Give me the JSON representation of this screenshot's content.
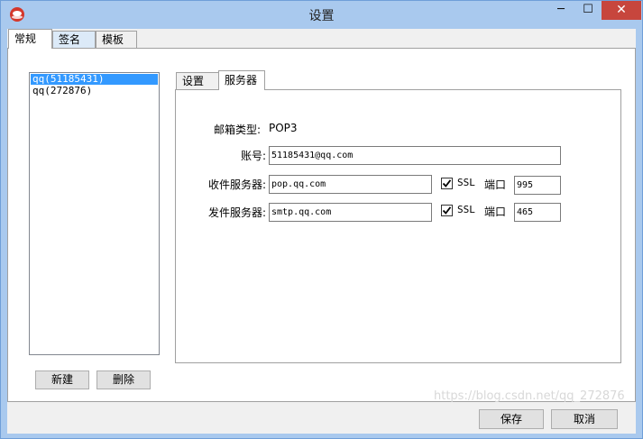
{
  "window": {
    "title": "设置",
    "min_glyph": "─",
    "max_glyph": "☐",
    "close_glyph": "✕"
  },
  "top_tabs": [
    "常规",
    "签名",
    "模板"
  ],
  "accounts": [
    "qq(51185431)",
    "qq(272876)"
  ],
  "list_buttons": {
    "new": "新建",
    "delete": "删除"
  },
  "inner_tabs": [
    "设置",
    "服务器"
  ],
  "server": {
    "mailbox_type_label": "邮箱类型:",
    "mailbox_type_value": "POP3",
    "account_label": "账号:",
    "account_value": "51185431@qq.com",
    "incoming_label": "收件服务器:",
    "incoming_value": "pop.qq.com",
    "outgoing_label": "发件服务器:",
    "outgoing_value": "smtp.qq.com",
    "ssl_label": "SSL",
    "port_label": "端口",
    "incoming_port": "995",
    "outgoing_port": "465"
  },
  "footer": {
    "save": "保存",
    "cancel": "取消"
  },
  "watermark": "https://blog.csdn.net/qq_272876"
}
